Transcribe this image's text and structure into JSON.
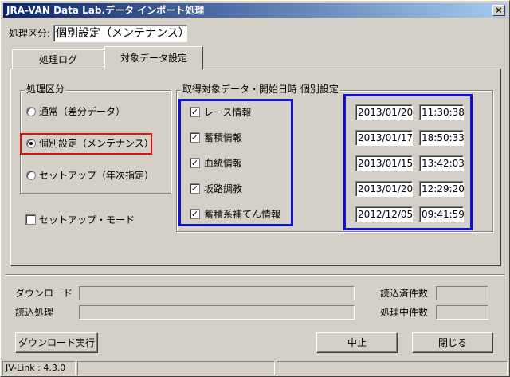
{
  "window": {
    "title": "JRA-VAN Data Lab.データ インポート処理",
    "close_label": "×"
  },
  "header": {
    "mode_label": "処理区分:",
    "mode_value": "個別設定（メンテナンス）"
  },
  "tabs": [
    {
      "label": "処理ログ",
      "active": false
    },
    {
      "label": "対象データ設定",
      "active": true
    }
  ],
  "process_group": {
    "title": "処理区分",
    "options": [
      {
        "label": "通常（差分データ）",
        "selected": false
      },
      {
        "label": "個別設定（メンテナンス）",
        "selected": true
      },
      {
        "label": "セットアップ（年次指定）",
        "selected": false
      }
    ]
  },
  "setup_mode": {
    "label": "セットアップ・モード",
    "checked": false
  },
  "data_group": {
    "title": "取得対象データ・開始日時 個別設定",
    "rows": [
      {
        "label": "レース情報",
        "checked": true,
        "date": "2013/01/20",
        "time": "11:30:38"
      },
      {
        "label": "蓄積情報",
        "checked": true,
        "date": "2013/01/17",
        "time": "18:50:33"
      },
      {
        "label": "血統情報",
        "checked": true,
        "date": "2013/01/15",
        "time": "13:42:03"
      },
      {
        "label": "坂路調教",
        "checked": true,
        "date": "2013/01/20",
        "time": "12:29:20"
      },
      {
        "label": "蓄積系補てん情報",
        "checked": true,
        "date": "2012/12/05",
        "time": "09:41:59"
      }
    ]
  },
  "progress": {
    "download_label": "ダウンロード",
    "read_label": "読込処理",
    "read_done_label": "読込済件数",
    "processing_label": "処理中件数",
    "download_pct": 0,
    "read_pct": 0
  },
  "buttons": {
    "download": "ダウンロード実行",
    "stop": "中止",
    "close": "閉じる"
  },
  "statusbar": {
    "version": "JV-Link : 4.3.0"
  },
  "colors": {
    "title_start": "#0a246a",
    "title_end": "#a6caf0",
    "highlight_red": "#e01010",
    "highlight_blue": "#1010d0"
  }
}
